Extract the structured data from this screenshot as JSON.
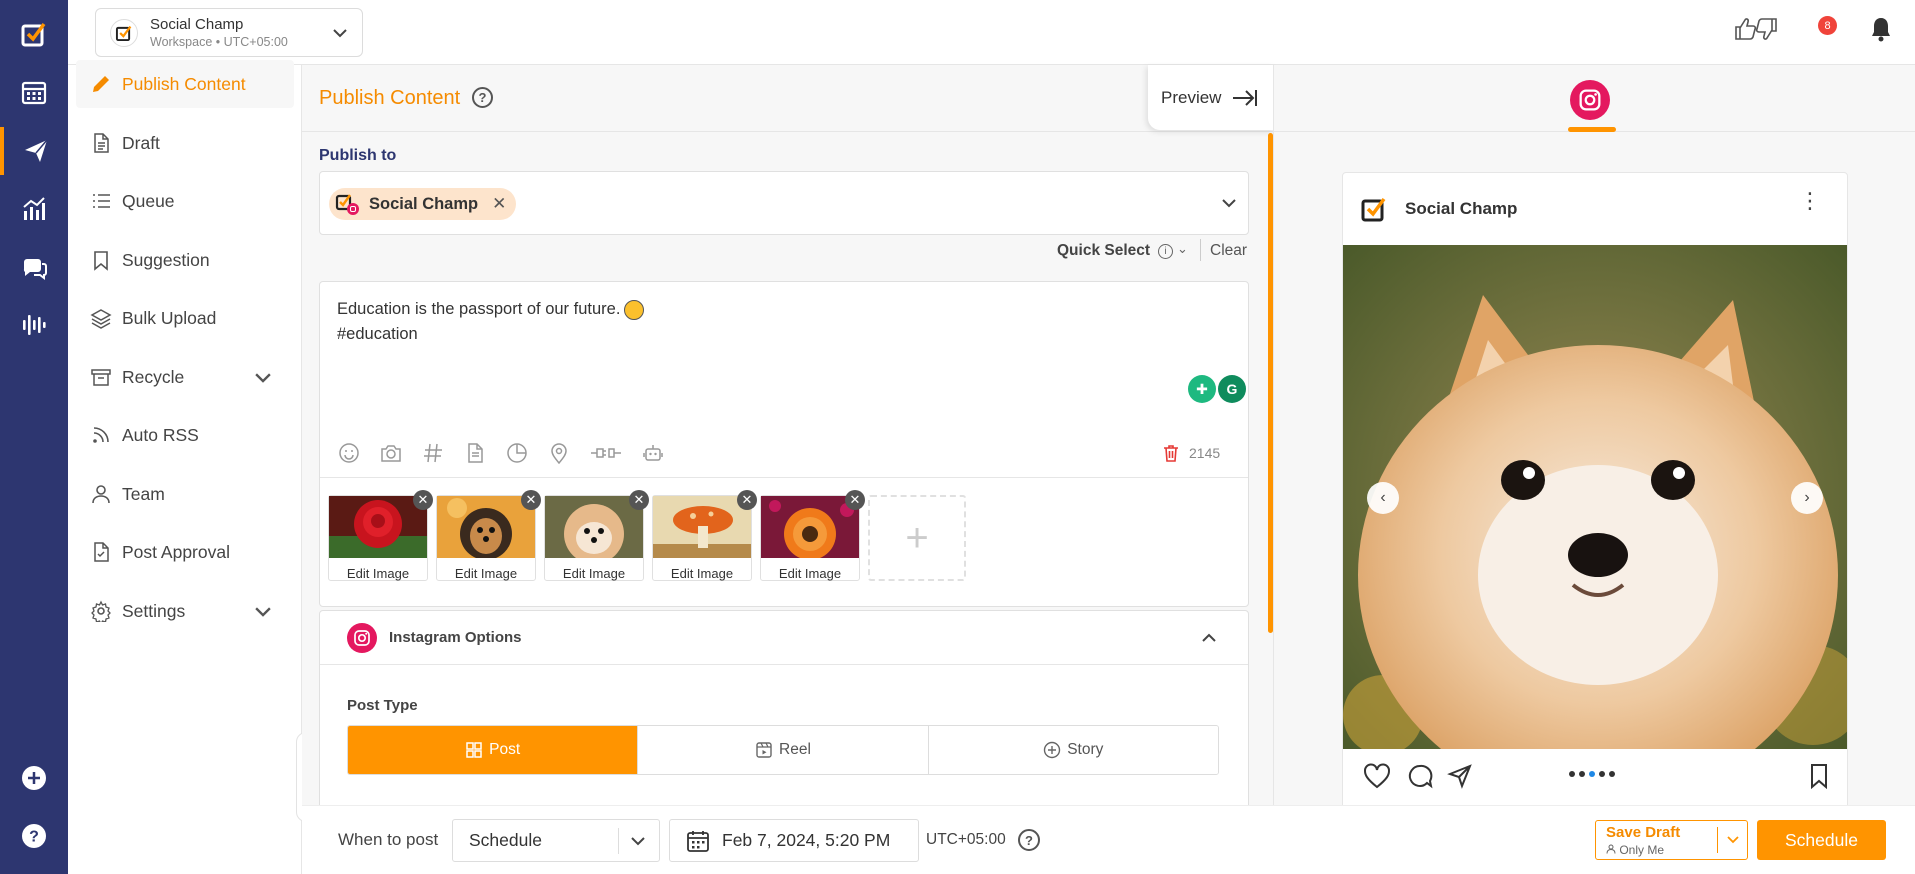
{
  "workspace": {
    "name": "Social Champ",
    "subtitle": "Workspace • UTC+05:00"
  },
  "notifications": {
    "count": "8"
  },
  "sidebar": {
    "items": [
      {
        "label": "Publish Content",
        "icon": "pencil-icon",
        "active": true
      },
      {
        "label": "Draft",
        "icon": "document-icon"
      },
      {
        "label": "Queue",
        "icon": "list-icon"
      },
      {
        "label": "Suggestion",
        "icon": "bookmark-icon"
      },
      {
        "label": "Bulk Upload",
        "icon": "layers-icon"
      },
      {
        "label": "Recycle",
        "icon": "archive-icon",
        "expandable": true
      },
      {
        "label": "Auto RSS",
        "icon": "rss-icon"
      },
      {
        "label": "Team",
        "icon": "user-icon"
      },
      {
        "label": "Post Approval",
        "icon": "approval-icon"
      },
      {
        "label": "Settings",
        "icon": "gear-icon",
        "expandable": true
      }
    ]
  },
  "main": {
    "title": "Publish Content",
    "preview_label": "Preview",
    "publish_to_label": "Publish to",
    "selected_account": "Social Champ",
    "quick_select_label": "Quick Select",
    "clear_label": "Clear",
    "post_text_line1": "Education is the passport of our future.",
    "post_text_line2": "#education",
    "char_count": "2145",
    "media": [
      {
        "label": "Edit Image",
        "subject": "red rose"
      },
      {
        "label": "Edit Image",
        "subject": "yorkshire terrier"
      },
      {
        "label": "Edit Image",
        "subject": "pomeranian puppy"
      },
      {
        "label": "Edit Image",
        "subject": "mushroom painting"
      },
      {
        "label": "Edit Image",
        "subject": "orange gerbera flower"
      }
    ],
    "instagram_options": {
      "title": "Instagram Options",
      "post_type_label": "Post Type",
      "post_types": [
        "Post",
        "Reel",
        "Story"
      ],
      "selected_post_type": "Post"
    }
  },
  "bottom": {
    "when_to_post_label": "When to post",
    "schedule_option": "Schedule",
    "date_time": "Feb 7, 2024, 5:20 PM",
    "timezone": "UTC+05:00",
    "save_draft_label": "Save Draft",
    "save_draft_scope": "Only Me",
    "schedule_button": "Schedule"
  },
  "preview": {
    "account_name": "Social Champ",
    "carousel_total": 5,
    "carousel_current": 3
  },
  "colors": {
    "brand_navy": "#2d3670",
    "accent_orange": "#ff9400",
    "instagram_pink": "#e4185f",
    "badge_red": "#f0433a"
  }
}
